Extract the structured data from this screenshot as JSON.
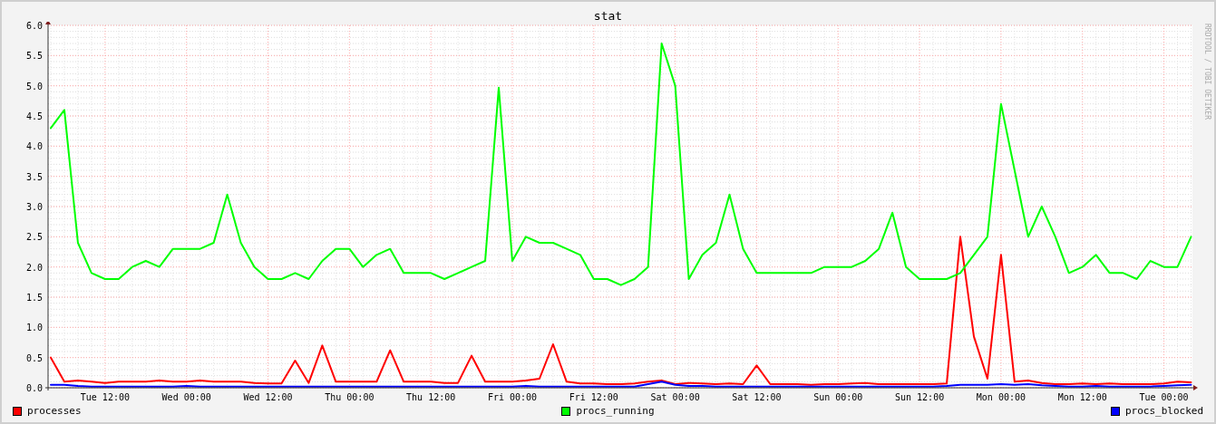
{
  "graph": {
    "credit": "RRDTOOL / TOBI OETIKER",
    "chart_data": {
      "type": "line",
      "title": "stat",
      "categories": [
        null,
        null,
        null,
        null,
        "Tue 12:00",
        null,
        null,
        null,
        null,
        null,
        "Wed 00:00",
        null,
        null,
        null,
        null,
        null,
        "Wed 12:00",
        null,
        null,
        null,
        null,
        null,
        "Thu 00:00",
        null,
        null,
        null,
        null,
        null,
        "Thu 12:00",
        null,
        null,
        null,
        null,
        null,
        "Fri 00:00",
        null,
        null,
        null,
        null,
        null,
        "Fri 12:00",
        null,
        null,
        null,
        null,
        null,
        "Sat 00:00",
        null,
        null,
        null,
        null,
        null,
        "Sat 12:00",
        null,
        null,
        null,
        null,
        null,
        "Sun 00:00",
        null,
        null,
        null,
        null,
        null,
        "Sun 12:00",
        null,
        null,
        null,
        null,
        null,
        "Mon 00:00",
        null,
        null,
        null,
        null,
        null,
        "Mon 12:00",
        null,
        null,
        null,
        null,
        null,
        "Tue 00:00",
        null,
        null
      ],
      "series": [
        {
          "name": "processes",
          "color": "#ff0000",
          "values": [
            0.5,
            0.1,
            0.12,
            0.1,
            0.08,
            0.1,
            0.1,
            0.1,
            0.12,
            0.1,
            0.1,
            0.12,
            0.1,
            0.1,
            0.1,
            0.08,
            0.07,
            0.07,
            0.45,
            0.08,
            0.7,
            0.1,
            0.1,
            0.1,
            0.1,
            0.62,
            0.1,
            0.1,
            0.1,
            0.08,
            0.08,
            0.53,
            0.1,
            0.1,
            0.1,
            0.12,
            0.15,
            0.72,
            0.1,
            0.07,
            0.07,
            0.06,
            0.06,
            0.07,
            0.1,
            0.12,
            0.06,
            0.08,
            0.07,
            0.06,
            0.07,
            0.06,
            0.37,
            0.06,
            0.06,
            0.06,
            0.05,
            0.06,
            0.06,
            0.07,
            0.08,
            0.06,
            0.06,
            0.06,
            0.06,
            0.06,
            0.07,
            2.5,
            0.85,
            0.15,
            2.2,
            0.1,
            0.12,
            0.08,
            0.06,
            0.06,
            0.07,
            0.06,
            0.07,
            0.06,
            0.06,
            0.06,
            0.07,
            0.1,
            0.09
          ]
        },
        {
          "name": "procs_running",
          "color": "#00ff00",
          "values": [
            4.3,
            4.6,
            2.4,
            1.9,
            1.8,
            1.8,
            2.0,
            2.1,
            2.0,
            2.3,
            2.3,
            2.3,
            2.4,
            3.2,
            2.4,
            2.0,
            1.8,
            1.8,
            1.9,
            1.8,
            2.1,
            2.3,
            2.3,
            2.0,
            2.2,
            2.3,
            1.9,
            1.9,
            1.9,
            1.8,
            1.9,
            2.0,
            2.1,
            4.97,
            2.1,
            2.5,
            2.4,
            2.4,
            2.3,
            2.2,
            1.8,
            1.8,
            1.7,
            1.8,
            2.0,
            5.7,
            5.0,
            1.8,
            2.2,
            2.4,
            3.2,
            2.3,
            1.9,
            1.9,
            1.9,
            1.9,
            1.9,
            2.0,
            2.0,
            2.0,
            2.1,
            2.3,
            2.9,
            2.0,
            1.8,
            1.8,
            1.8,
            1.9,
            2.2,
            2.5,
            4.7,
            3.6,
            2.5,
            3.0,
            2.5,
            1.9,
            2.0,
            2.2,
            1.9,
            1.9,
            1.8,
            2.1,
            2.0,
            2.0,
            2.5
          ]
        },
        {
          "name": "procs_blocked",
          "color": "#0000ff",
          "values": [
            0.05,
            0.05,
            0.03,
            0.02,
            0.02,
            0.02,
            0.02,
            0.02,
            0.02,
            0.02,
            0.03,
            0.02,
            0.02,
            0.02,
            0.02,
            0.02,
            0.02,
            0.02,
            0.02,
            0.02,
            0.02,
            0.02,
            0.02,
            0.02,
            0.02,
            0.02,
            0.02,
            0.02,
            0.02,
            0.02,
            0.02,
            0.02,
            0.02,
            0.02,
            0.02,
            0.03,
            0.02,
            0.02,
            0.02,
            0.02,
            0.02,
            0.02,
            0.02,
            0.02,
            0.06,
            0.1,
            0.05,
            0.03,
            0.03,
            0.02,
            0.02,
            0.02,
            0.02,
            0.02,
            0.02,
            0.02,
            0.02,
            0.02,
            0.02,
            0.02,
            0.02,
            0.02,
            0.02,
            0.02,
            0.02,
            0.02,
            0.03,
            0.05,
            0.05,
            0.05,
            0.06,
            0.05,
            0.06,
            0.04,
            0.03,
            0.02,
            0.02,
            0.03,
            0.02,
            0.02,
            0.02,
            0.02,
            0.03,
            0.04,
            0.05
          ]
        }
      ],
      "ylim": [
        0,
        6
      ],
      "grid": true,
      "yticks": [
        {
          "value": 0,
          "label": "0.0"
        },
        {
          "value": 0.5,
          "label": "0.5"
        },
        {
          "value": 1,
          "label": "1.0"
        },
        {
          "value": 1.5,
          "label": "1.5"
        },
        {
          "value": 2,
          "label": "2.0"
        },
        {
          "value": 2.5,
          "label": "2.5"
        },
        {
          "value": 3,
          "label": "3.0"
        },
        {
          "value": 3.5,
          "label": "3.5"
        },
        {
          "value": 4,
          "label": "4.0"
        },
        {
          "value": 4.5,
          "label": "4.5"
        },
        {
          "value": 5,
          "label": "5.0"
        },
        {
          "value": 5.5,
          "label": "5.5"
        },
        {
          "value": 6,
          "label": "6.0"
        }
      ]
    }
  }
}
